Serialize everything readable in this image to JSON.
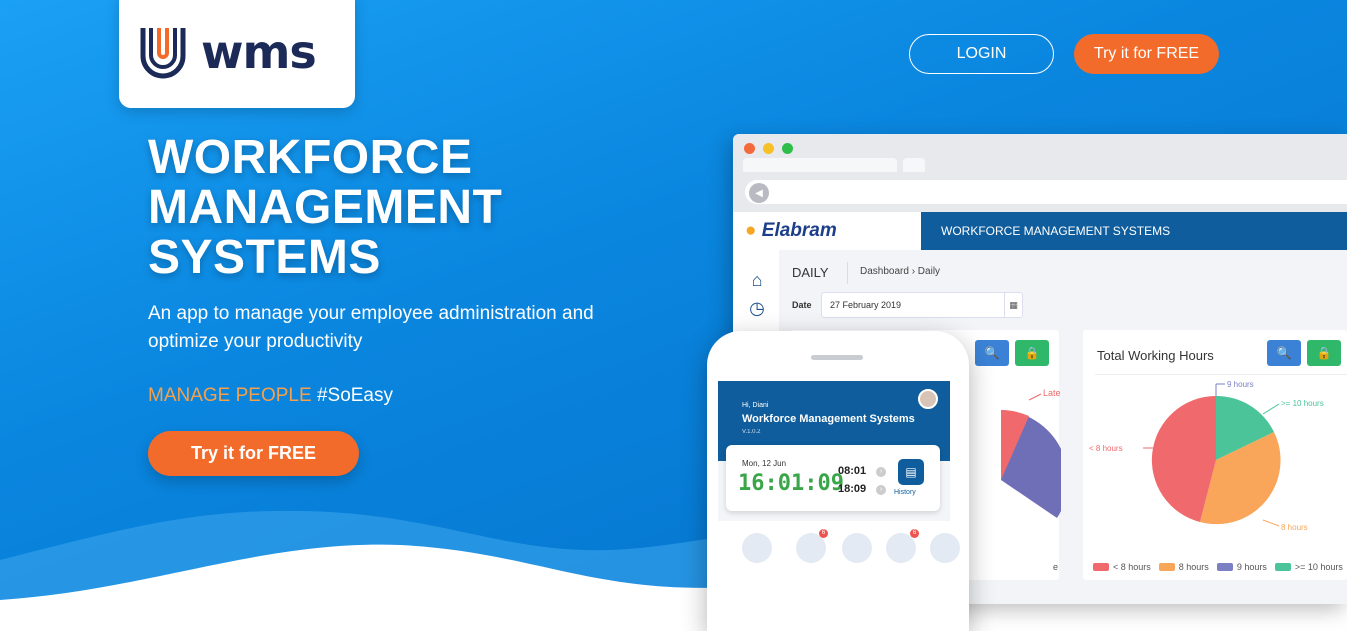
{
  "brand": {
    "name": "wms"
  },
  "header": {
    "login_label": "LOGIN",
    "try_label": "Try it for FREE"
  },
  "hero": {
    "title_lines": [
      "WORKFORCE",
      "MANAGEMENT",
      "SYSTEMS"
    ],
    "subtitle": "An app to manage your employee administration and optimize your productivity",
    "tag_accent": "MANAGE PEOPLE",
    "tag_rest": " #SoEasy",
    "cta_label": "Try it for FREE"
  },
  "dashboard": {
    "logo_text": "Elabram",
    "app_title": "WORKFORCE MANAGEMENT SYSTEMS",
    "page_title": "DAILY",
    "breadcrumb": "Dashboard  ›  Daily",
    "date_label": "Date",
    "date_value": "27 February 2019",
    "card_left_label": "Late",
    "card_left_footer": "e",
    "card_right": {
      "title": "Total Working Hours",
      "labels": [
        "9 hours",
        ">= 10 hours",
        "< 8 hours",
        "8 hours"
      ],
      "legend": [
        "< 8 hours",
        "8 hours",
        "9 hours",
        ">= 10 hours"
      ]
    },
    "colors": {
      "lt8": "#f06a6d",
      "h8": "#f9a55a",
      "h9": "#7b7fc4",
      "ge10": "#4cc49a",
      "late_pie": "#6f6fb8"
    }
  },
  "phone": {
    "greeting": "Hi, Diani",
    "title": "Workforce Management Systems",
    "version": "V.1.0.2",
    "date": "Mon, 12 Jun",
    "clock": "16:01:09",
    "in_time": "08:01",
    "out_time": "18:09",
    "history_label": "History",
    "badges": [
      "6",
      "6"
    ]
  }
}
